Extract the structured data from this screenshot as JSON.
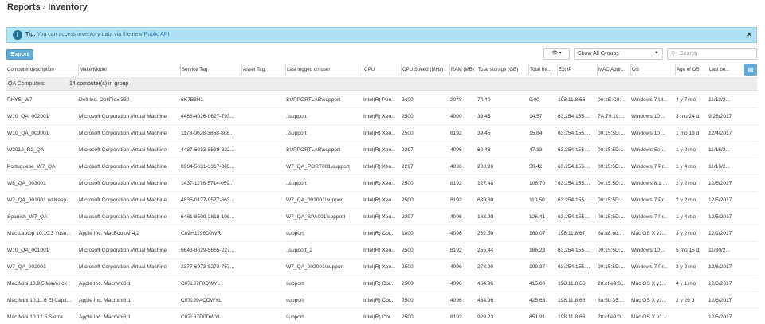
{
  "breadcrumb": {
    "parent": "Reports",
    "separator": "›",
    "current": "Inventory"
  },
  "alert": {
    "icon": "info-icon",
    "tip_label": "Tip:",
    "message": "You can access inventory data via the new",
    "link": "Public API",
    "close": "×"
  },
  "toolbar": {
    "export_label": "Export",
    "eye_label": "👁 ▾",
    "group_select": "Show All Groups",
    "search_placeholder": "Search"
  },
  "table": {
    "columns": [
      "Computer description",
      "Make/Model",
      "Service Tag",
      "Asset Tag",
      "Last logged on user",
      "CPU",
      "CPU Speed (MHz)",
      "RAM (MB)",
      "Total storage (GB)",
      "Total fre...",
      "Ext IP",
      "MAC Addr...",
      "OS",
      "Age of OS",
      "Last bo..."
    ],
    "group": {
      "name": "QA Computers",
      "count": "14 computer(s) in group"
    },
    "rows": [
      [
        "PHYS_W7",
        "Dell Inc. OptiPlex 330",
        "6K7B3H1",
        "",
        "SUPPORTLAB\\support",
        "Intel(R) Pen...",
        "2400",
        "2048",
        "74.40",
        "0.00",
        "198.11.8.66",
        "00:1E:C9:...",
        "Windows 7 Ul...",
        "4 y 7 mo",
        "11/13/2..."
      ],
      [
        "W10_QA_002001",
        "Microsoft Corporation Virtual Machine",
        "4488-4026-0627-793...",
        "",
        ".\\support",
        "Intel(R) Xeo...",
        "2500",
        "4000",
        "39.45",
        "14.57",
        "63.254.155....",
        "7A:79:19:...",
        "Windows 10 ...",
        "3 mo 24 d",
        "9/26/2017"
      ],
      [
        "W10_QA_003001",
        "Microsoft Corporation Virtual Machine",
        "1173-0026-3858-808...",
        "",
        ".\\support",
        "Intel(R) Xeo...",
        "2500",
        "8192",
        "39.45",
        "15.84",
        "63.254.155....",
        "00:15:5D:...",
        "Windows 10 ...",
        "1 mo 18 d",
        "12/4/2017"
      ],
      [
        "W2012_R2_QA",
        "Microsoft Corporation Virtual Machine",
        "4437-6033-8539-822...",
        "",
        "SUPPORTLAB\\support",
        "Intel(R) Xeo...",
        "2297",
        "4096",
        "62.48",
        "47.13",
        "63.254.155....",
        "00:15:5D:...",
        "Windows Ser...",
        "1 y 2 mo",
        "11/16/2..."
      ],
      [
        "Portuguese_W7_QA",
        "Microsoft Corporation Virtual Machine",
        "0964-5031-3317-365...",
        "",
        "W7_QA_PORT001\\support",
        "Intel(R) Xeo...",
        "2297",
        "4096",
        "200.90",
        "50.42",
        "63.254.155....",
        "00:15:5D:...",
        "Windows 7 Pr...",
        "1 y 4 mo",
        "11/16/2..."
      ],
      [
        "W8_QA_003001",
        "Microsoft Corporation Virtual Machine",
        "1437-1176-5714-059...",
        "",
        ".\\support",
        "Intel(R) Xeo...",
        "2500",
        "8192",
        "127.48",
        "108.70",
        "63.254.155....",
        "00:15:5D:...",
        "Windows 8.1 ...",
        "2 y 2 mo",
        "12/6/2017"
      ],
      [
        "W7_QA_001001 w/ Kasp...",
        "Microsoft Corporation Virtual Machine",
        "4835-0177-9577-663...",
        "",
        "W7_QA_001001\\support",
        "Intel(R) Xeo...",
        "2500",
        "8192",
        "639.80",
        "110.50",
        "63.254.155....",
        "00:15:5D:...",
        "Windows 7 Pr...",
        "2 y 2 mo",
        "12/5/2017"
      ],
      [
        "Spanish_W7_QA",
        "Microsoft Corporation Virtual Machine",
        "6481-8509-2818-108...",
        "",
        "W7_QA_SPA001\\support",
        "Intel(R) Xeo...",
        "2297",
        "4096",
        "163.90",
        "126.41",
        "63.254.155....",
        "00:15:5D:...",
        "Windows 7 Pr...",
        "1 y 4 mo",
        "12/5/2017"
      ],
      [
        "Mac Laptop 10.10.3 Yose...",
        "Apple Inc. MacBookAir4,2",
        "C02H1196DJWR",
        "",
        "support",
        "Intel(R) Cor...",
        "1800",
        "4096",
        "232.50",
        "169.07",
        "198.11.8.67",
        "68:a8:6d:...",
        "Mac OS X v1...",
        "3 y 2 mo",
        "12/1/2017"
      ],
      [
        "W10_QA_001001",
        "Microsoft Corporation Virtual Machine",
        "6643-8629-5665-227...",
        "",
        ".\\support_2",
        "Intel(R) Xeo...",
        "2500",
        "8192",
        "255.44",
        "186.23",
        "63.254.155....",
        "00:15:5D:...",
        "Windows 10 ...",
        "5 mo 15 d",
        "11/30/2..."
      ],
      [
        "W7_QA_002001",
        "Microsoft Corporation Virtual Machine",
        "2377-6973-8273-757...",
        "",
        "W7_QA_002001\\support",
        "Intel(R) Xeo...",
        "2500",
        "4096",
        "278.90",
        "199.37",
        "63.254.155....",
        "00:15:5D:...",
        "Windows 7 Pr...",
        "2 y 2 mo",
        "12/6/2017"
      ],
      [
        "Mac Mini 10.9.5 Maverick",
        "Apple Inc. Macmini6,1",
        "C07LJ7F8DWYL",
        "",
        "support",
        "Intel(R) Cor...",
        "2500",
        "4096",
        "464.96",
        "415.00",
        "198.11.8.66",
        "28:cf:e9:0...",
        "Mac OS X v1...",
        "4 y 1 mo",
        "12/6/2017"
      ],
      [
        "Mac Mini 10.11.6 El Capit...",
        "Apple Inc. Macmini6,1",
        "C07LJ9ACDWYL",
        "",
        "support",
        "Intel(R) Cor...",
        "2500",
        "4096",
        "464.96",
        "425.63",
        "198.11.8.66",
        "6a:5b:35:...",
        "Mac OS X v1...",
        "2 y 26 d",
        "12/6/2017"
      ],
      [
        "Mac Mini 10.12.5 Sierra",
        "Apple Inc. Macmini6,1",
        "C07L67D0DWYL",
        "",
        "support",
        "Intel(R) Cor...",
        "2500",
        "8192",
        "929.23",
        "851.91",
        "198.11.8.66",
        "28:cf:e9:0...",
        "Mac OS X v1...",
        "",
        "12/5/2017"
      ]
    ]
  },
  "colors": {
    "accent": "#5dabd6",
    "alert_bg": "#b1e2f3",
    "link": "#2a7bb7",
    "group_bg": "#ececec"
  }
}
